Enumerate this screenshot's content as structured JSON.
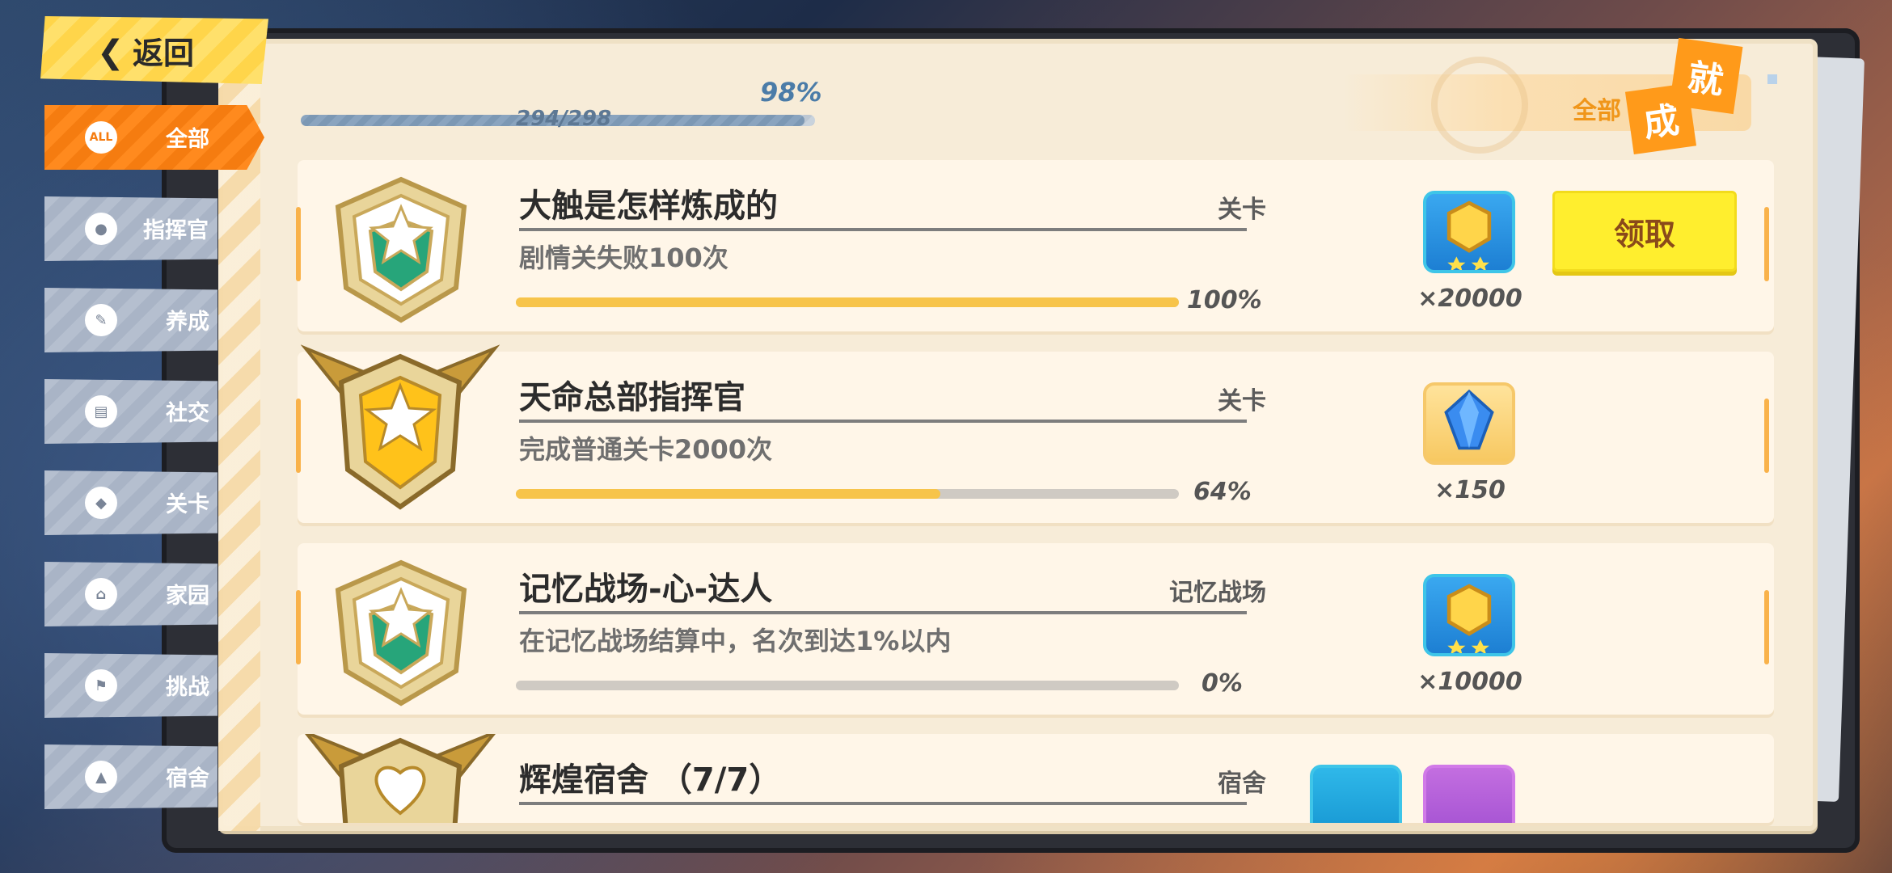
{
  "back_button": {
    "label": "返回"
  },
  "sidebar": {
    "items": [
      {
        "label": "全部",
        "icon": "all-icon",
        "icon_text": "ALL",
        "active": true
      },
      {
        "label": "指挥官",
        "icon": "commander-icon",
        "icon_text": "",
        "active": false
      },
      {
        "label": "养成",
        "icon": "growth-icon",
        "icon_text": "",
        "active": false
      },
      {
        "label": "社交",
        "icon": "social-icon",
        "icon_text": "",
        "active": false
      },
      {
        "label": "关卡",
        "icon": "stage-icon",
        "icon_text": "",
        "active": false
      },
      {
        "label": "家园",
        "icon": "home-icon",
        "icon_text": "",
        "active": false
      },
      {
        "label": "挑战",
        "icon": "challenge-icon",
        "icon_text": "",
        "active": false
      },
      {
        "label": "宿舍",
        "icon": "dorm-icon",
        "icon_text": "",
        "active": false
      }
    ]
  },
  "overall_progress": {
    "percent_text": "98%",
    "count_text": "294/298",
    "fraction": 0.98
  },
  "tab": {
    "label": "全部",
    "badge_1": "成",
    "badge_2": "就"
  },
  "achievements": [
    {
      "title": "大触是怎样炼成的",
      "category": "关卡",
      "description": "剧情关失败100次",
      "progress_fraction": 1.0,
      "progress_text": "100%",
      "badge_style": "green",
      "rewards": [
        {
          "icon": "gold-coin-icon",
          "count": "×20000",
          "color": "blue"
        }
      ],
      "claim_label": "领取"
    },
    {
      "title": "天命总部指挥官",
      "category": "关卡",
      "description": "完成普通关卡2000次",
      "progress_fraction": 0.64,
      "progress_text": "64%",
      "badge_style": "gold",
      "rewards": [
        {
          "icon": "blue-crystal-icon",
          "count": "×150",
          "color": "orange"
        }
      ]
    },
    {
      "title": "记忆战场-心-达人",
      "category": "记忆战场",
      "description": "在记忆战场结算中，名次到达1%以内",
      "progress_fraction": 0.0,
      "progress_text": "0%",
      "badge_style": "green",
      "rewards": [
        {
          "icon": "gold-coin-icon",
          "count": "×10000",
          "color": "blue"
        }
      ]
    },
    {
      "title": "辉煌宿舍 （7/7）",
      "category": "宿舍",
      "badge_style": "gold-heart",
      "rewards": [
        {
          "icon": "furniture-paint-icon",
          "color": "teal"
        },
        {
          "icon": "building-blocks-icon",
          "color": "purple"
        }
      ]
    }
  ]
}
